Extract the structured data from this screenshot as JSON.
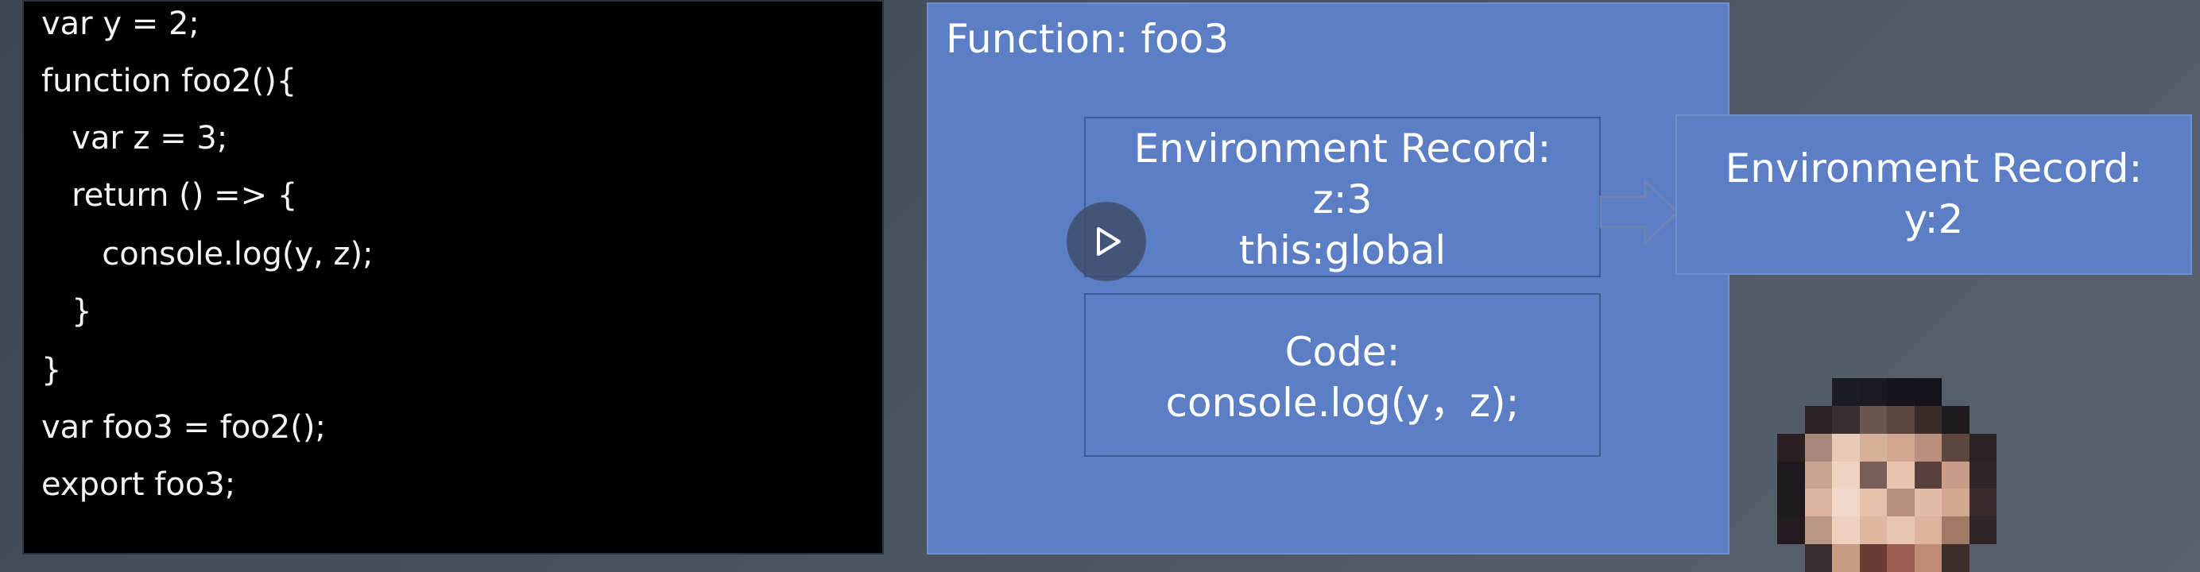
{
  "code_panel": {
    "lines": [
      "var y = 2;",
      "function foo2(){",
      "   var z = 3;",
      "   return () => {",
      "      console.log(y, z);",
      "   }",
      "}",
      "var foo3 = foo2();",
      "export foo3;"
    ]
  },
  "function_box": {
    "title": "Function: foo3",
    "environment_record": {
      "label": "Environment Record:",
      "entries": [
        "z:3",
        "this:global"
      ]
    },
    "code": {
      "label": "Code:",
      "value": "console.log(y，z);"
    }
  },
  "outer_environment_record": {
    "label": "Environment Record:",
    "entries": [
      "y:2"
    ]
  },
  "icons": {
    "play": "play-icon",
    "arrow": "arrow-right-icon",
    "avatar": "avatar-image"
  },
  "colors": {
    "code_background": "#000000",
    "box_fill": "#5b7ec4",
    "page_background": "#4a5260"
  }
}
